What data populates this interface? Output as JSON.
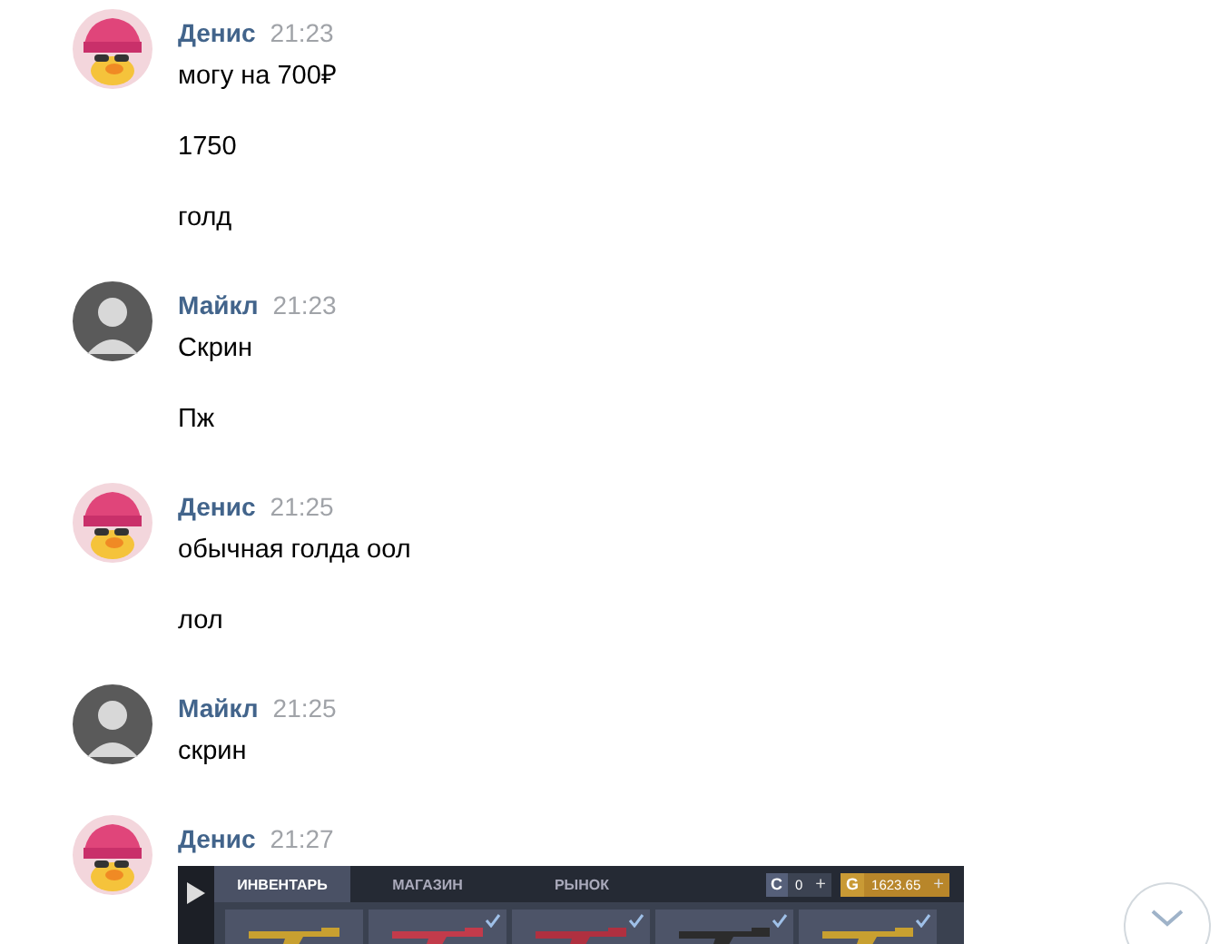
{
  "messages": [
    {
      "author": "Денис",
      "kind": "duck",
      "time": "21:23",
      "lines": [
        "могу на 700₽",
        "1750",
        "голд"
      ]
    },
    {
      "author": "Майкл",
      "kind": "portrait",
      "time": "21:23",
      "lines": [
        "Скрин",
        "Пж"
      ]
    },
    {
      "author": "Денис",
      "kind": "duck",
      "time": "21:25",
      "lines": [
        "обычная голда оол",
        "лол"
      ]
    },
    {
      "author": "Майкл",
      "kind": "portrait",
      "time": "21:25",
      "lines": [
        "скрин"
      ]
    },
    {
      "author": "Денис",
      "kind": "duck",
      "time": "21:27",
      "attachment": {
        "tabs": [
          {
            "label": "ИНВЕНТАРЬ",
            "selected": true
          },
          {
            "label": "МАГАЗИН",
            "selected": false
          },
          {
            "label": "РЫНОК",
            "selected": false
          }
        ],
        "currencies": [
          {
            "kind": "silver",
            "letter": "C",
            "amount": "0",
            "plus": "+"
          },
          {
            "kind": "gold",
            "letter": "G",
            "amount": "1623.65",
            "plus": "+"
          }
        ],
        "items": [
          {
            "checked": false
          },
          {
            "checked": true
          },
          {
            "checked": true
          },
          {
            "checked": true
          },
          {
            "checked": true
          }
        ]
      }
    }
  ]
}
